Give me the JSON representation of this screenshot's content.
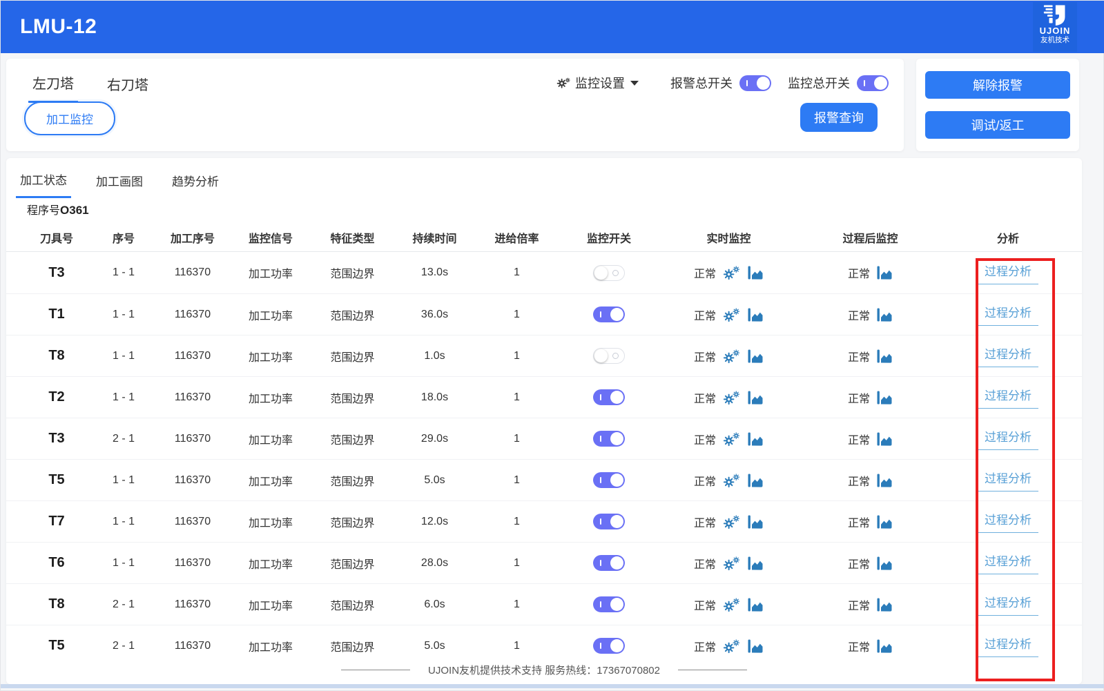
{
  "header": {
    "title": "LMU-12",
    "brand": "UJOIN",
    "brand_sub": "友机技术"
  },
  "toolbar": {
    "turret_tabs": [
      {
        "label": "左刀塔",
        "active": true
      },
      {
        "label": "右刀塔",
        "active": false
      }
    ],
    "machining_monitor_button": "加工监控",
    "monitor_settings_label": "监控设置",
    "alarm_master_switch_label": "报警总开关",
    "alarm_master_switch_on": true,
    "monitor_master_switch_label": "监控总开关",
    "monitor_master_switch_on": true,
    "alarm_query_button": "报警查询"
  },
  "actions": {
    "clear_alarm_button": "解除报警",
    "debug_rework_button": "调试/返工"
  },
  "main": {
    "tabs": [
      {
        "label": "加工状态",
        "active": true
      },
      {
        "label": "加工画图",
        "active": false
      },
      {
        "label": "趋势分析",
        "active": false
      }
    ],
    "program_label": "程序号",
    "program_number": "O361",
    "table": {
      "columns": [
        "刀具号",
        "序号",
        "加工序号",
        "监控信号",
        "特征类型",
        "持续时间",
        "进给倍率",
        "监控开关",
        "实时监控",
        "过程后监控",
        "分析"
      ],
      "rows": [
        {
          "tool": "T3",
          "seq": "1 - 1",
          "process_no": "116370",
          "signal": "加工功率",
          "feature_type": "范围边界",
          "duration": "13.0s",
          "feed_rate": "1",
          "monitor_on": false,
          "realtime_status": "正常",
          "post_status": "正常",
          "analysis_label": "过程分析"
        },
        {
          "tool": "T1",
          "seq": "1 - 1",
          "process_no": "116370",
          "signal": "加工功率",
          "feature_type": "范围边界",
          "duration": "36.0s",
          "feed_rate": "1",
          "monitor_on": true,
          "realtime_status": "正常",
          "post_status": "正常",
          "analysis_label": "过程分析"
        },
        {
          "tool": "T8",
          "seq": "1 - 1",
          "process_no": "116370",
          "signal": "加工功率",
          "feature_type": "范围边界",
          "duration": "1.0s",
          "feed_rate": "1",
          "monitor_on": false,
          "realtime_status": "正常",
          "post_status": "正常",
          "analysis_label": "过程分析"
        },
        {
          "tool": "T2",
          "seq": "1 - 1",
          "process_no": "116370",
          "signal": "加工功率",
          "feature_type": "范围边界",
          "duration": "18.0s",
          "feed_rate": "1",
          "monitor_on": true,
          "realtime_status": "正常",
          "post_status": "正常",
          "analysis_label": "过程分析"
        },
        {
          "tool": "T3",
          "seq": "2 - 1",
          "process_no": "116370",
          "signal": "加工功率",
          "feature_type": "范围边界",
          "duration": "29.0s",
          "feed_rate": "1",
          "monitor_on": true,
          "realtime_status": "正常",
          "post_status": "正常",
          "analysis_label": "过程分析"
        },
        {
          "tool": "T5",
          "seq": "1 - 1",
          "process_no": "116370",
          "signal": "加工功率",
          "feature_type": "范围边界",
          "duration": "5.0s",
          "feed_rate": "1",
          "monitor_on": true,
          "realtime_status": "正常",
          "post_status": "正常",
          "analysis_label": "过程分析"
        },
        {
          "tool": "T7",
          "seq": "1 - 1",
          "process_no": "116370",
          "signal": "加工功率",
          "feature_type": "范围边界",
          "duration": "12.0s",
          "feed_rate": "1",
          "monitor_on": true,
          "realtime_status": "正常",
          "post_status": "正常",
          "analysis_label": "过程分析"
        },
        {
          "tool": "T6",
          "seq": "1 - 1",
          "process_no": "116370",
          "signal": "加工功率",
          "feature_type": "范围边界",
          "duration": "28.0s",
          "feed_rate": "1",
          "monitor_on": true,
          "realtime_status": "正常",
          "post_status": "正常",
          "analysis_label": "过程分析"
        },
        {
          "tool": "T8",
          "seq": "2 - 1",
          "process_no": "116370",
          "signal": "加工功率",
          "feature_type": "范围边界",
          "duration": "6.0s",
          "feed_rate": "1",
          "monitor_on": true,
          "realtime_status": "正常",
          "post_status": "正常",
          "analysis_label": "过程分析"
        },
        {
          "tool": "T5",
          "seq": "2 - 1",
          "process_no": "116370",
          "signal": "加工功率",
          "feature_type": "范围边界",
          "duration": "5.0s",
          "feed_rate": "1",
          "monitor_on": true,
          "realtime_status": "正常",
          "post_status": "正常",
          "analysis_label": "过程分析"
        }
      ]
    }
  },
  "footer": {
    "support_text": "UJOIN友机提供技术支持 服务热线：17367070802"
  },
  "icons": {
    "settings": "gear-icon",
    "dropdown": "caret-down-icon",
    "realtime_config": "double-gears-icon",
    "trend_chart": "area-chart-icon",
    "brand": "ujoin-logo-icon"
  },
  "colors": {
    "header_blue": "#2566e8",
    "accent_blue": "#2d7bf4",
    "toggle_on": "#6a70f5",
    "link_blue": "#58a0d6",
    "icon_blue": "#2b7cba",
    "highlight_red": "#ec1f1f"
  }
}
